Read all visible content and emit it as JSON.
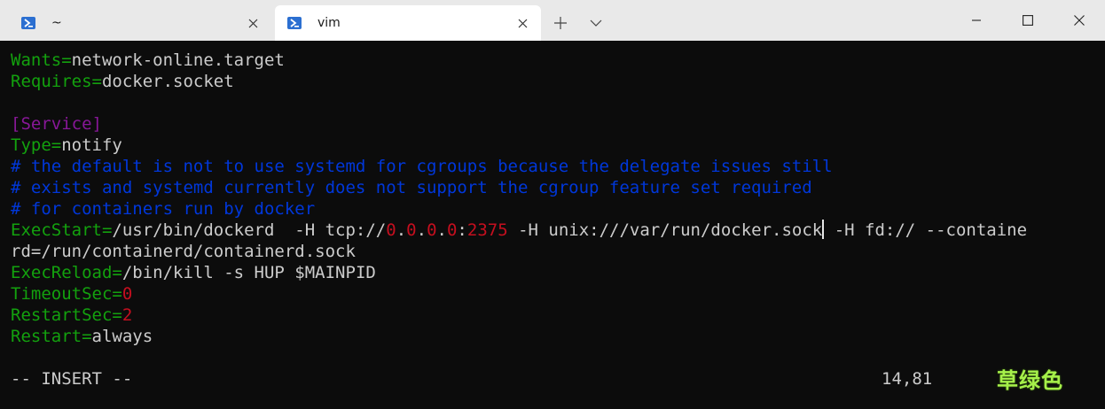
{
  "tabs": [
    {
      "title": "~",
      "active": false,
      "icon": "powershell-icon"
    },
    {
      "title": "vim",
      "active": true,
      "icon": "powershell-icon"
    }
  ],
  "titlebar": {
    "newtab_icon": "plus-icon",
    "dropdown_icon": "chevron-down-icon",
    "minimize_icon": "minimize-icon",
    "maximize_icon": "maximize-icon",
    "close_icon": "close-icon"
  },
  "editor": {
    "line1": {
      "key": "Wants=",
      "value": "network-online.target"
    },
    "line2": {
      "key": "Requires=",
      "value": "docker.socket"
    },
    "line3": "",
    "line4": "[Service]",
    "line5": {
      "key": "Type=",
      "value": "notify"
    },
    "line6": "# the default is not to use systemd for cgroups because the delegate issues still",
    "line7": "# exists and systemd currently does not support the cgroup feature set required",
    "line8": "# for containers run by docker",
    "line9": {
      "key": "ExecStart=",
      "p1": "/usr/bin/dockerd  -H tcp://",
      "n1": "0",
      "d1": ".",
      "n2": "0",
      "d2": ".",
      "n3": "0",
      "d3": ".",
      "n4": "0",
      "colon": ":",
      "port": "2375",
      "p2": " -H unix:///var/run/docker.sock",
      "p3": " -H fd:// --containe"
    },
    "line10": "rd=/run/containerd/containerd.sock",
    "line11": {
      "key": "ExecReload=",
      "value": "/bin/kill -s HUP $MAINPID"
    },
    "line12": {
      "key": "TimeoutSec=",
      "value": "0"
    },
    "line13": {
      "key": "RestartSec=",
      "value": "2"
    },
    "line14": {
      "key": "Restart=",
      "value": "always"
    }
  },
  "status": {
    "mode": "-- INSERT --",
    "position": "14,81"
  },
  "watermark": "草绿色",
  "colors": {
    "background": "#0c0c0c",
    "key": "#13a10e",
    "section": "#881798",
    "comment": "#0037da",
    "number": "#c50f1f",
    "text": "#cccccc",
    "watermark": "#a6f04a"
  }
}
